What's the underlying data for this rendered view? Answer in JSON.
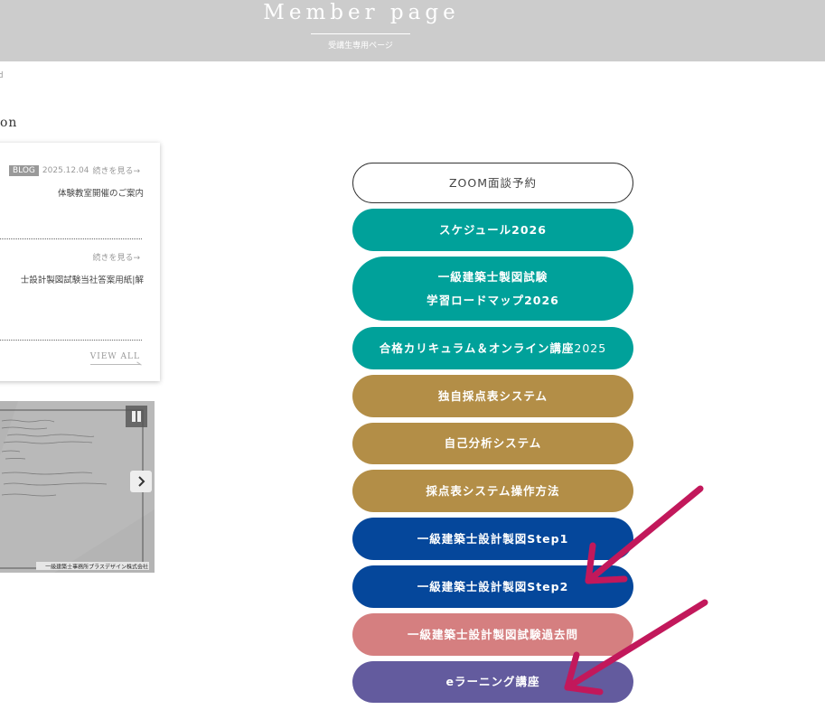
{
  "header": {
    "title": "Member page",
    "subtitle": "受講生専用ページ"
  },
  "breadcrumb": "ｄ",
  "section": {
    "heading": "on"
  },
  "news": {
    "items": [
      {
        "badge": "BLOG",
        "date": "2025.12.04",
        "more_label": "続きを見る→",
        "title": "体験教室開催のご案内"
      },
      {
        "more_label": "続きを見る→",
        "title": "士設計製図試験当社答案用紙|解"
      }
    ],
    "view_all_label": "VIEW ALL"
  },
  "slider": {
    "caption": "一級建築士事務所プラスデザイン株式会社",
    "pause_icon": "pause-icon",
    "next_icon": "chevron-right-icon"
  },
  "menu": {
    "buttons": [
      {
        "label": "ZOOM面談予約",
        "color": "#ffffff"
      },
      {
        "label": "スケジュール2026",
        "color": "#00a19a"
      },
      {
        "label_line1": "一級建築士製図試験",
        "label_line2": "学習ロードマップ2026",
        "color": "#00a19a"
      },
      {
        "label_bold": "合格カリキュラム＆オンライン講座",
        "label_regular": "2025",
        "color": "#00a19a"
      },
      {
        "label": "独自採点表システム",
        "color": "#b38e47"
      },
      {
        "label": "自己分析システム",
        "color": "#b38e47"
      },
      {
        "label": "採点表システム操作方法",
        "color": "#b38e47"
      },
      {
        "label": "一級建築士設計製図Step1",
        "color": "#05479b"
      },
      {
        "label": "一級建築士設計製図Step2",
        "color": "#05479b"
      },
      {
        "label": "一級建築士設計製図試験過去問",
        "color": "#d57f80"
      },
      {
        "label": "eラーニング講座",
        "color": "#635b9e"
      }
    ]
  },
  "annotations": {
    "arrow_color": "#c2185b"
  }
}
